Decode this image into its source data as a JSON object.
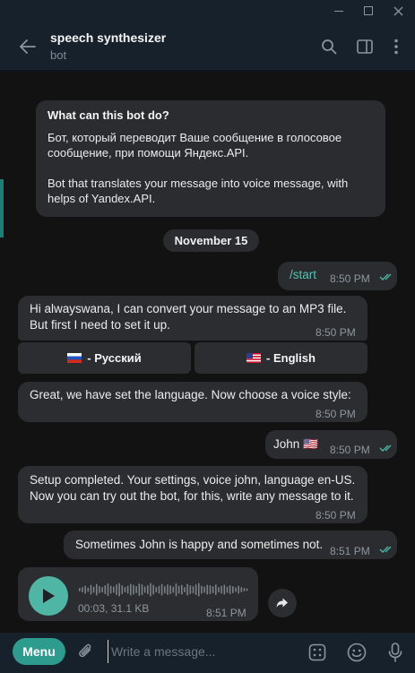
{
  "window": {
    "controls": {
      "minimize": "—",
      "maximize": "☐",
      "close": "✕"
    }
  },
  "header": {
    "title": "speech synthesizer",
    "subtitle": "bot",
    "icons": [
      "back-arrow-icon",
      "search-icon",
      "sidebar-toggle-icon",
      "more-vert-icon"
    ]
  },
  "intro": {
    "title": "What can this bot do?",
    "text": "Бот, который переводит Ваше сообщение в голосовое сообщение, при помощи Яндекс.API.\n\nBot that translates your message into voice message, with helps of Yandex.API."
  },
  "date_separator": "November 15",
  "messages": [
    {
      "id": "m1",
      "direction": "out",
      "text": "/start",
      "time": "8:50 PM",
      "read": true
    },
    {
      "id": "m2",
      "direction": "in",
      "text": "Hi alwayswana, I can convert your message to an MP3 file. But first I need to set it up.",
      "time": "8:50 PM"
    },
    {
      "id": "m3",
      "direction": "in",
      "text": "Great, we have set the language. Now choose a voice style:",
      "time": "8:50 PM"
    },
    {
      "id": "m4",
      "direction": "out",
      "text": "John 🇺🇸",
      "time": "8:50 PM",
      "read": true
    },
    {
      "id": "m5",
      "direction": "in",
      "text": "Setup completed. Your settings, voice john, language en-US. Now you can try out the bot, for this, write any message to it.",
      "time": "8:50 PM"
    },
    {
      "id": "m6",
      "direction": "out",
      "text": "Sometimes John is happy and sometimes not.",
      "time": "8:51 PM",
      "read": true
    }
  ],
  "keyboard": [
    {
      "label": "- Русский",
      "flag": "ru"
    },
    {
      "label": "- English",
      "flag": "us"
    }
  ],
  "voice_message": {
    "meta": "00:03, 31.1 KB",
    "time": "8:51 PM"
  },
  "composer": {
    "menu_label": "Menu",
    "placeholder": "Write a message..."
  },
  "colors": {
    "accent": "#2e9b8f",
    "read_ticks": "#4fb5a5",
    "chat_bg": "#121212",
    "bubble": "#2b2d31"
  }
}
